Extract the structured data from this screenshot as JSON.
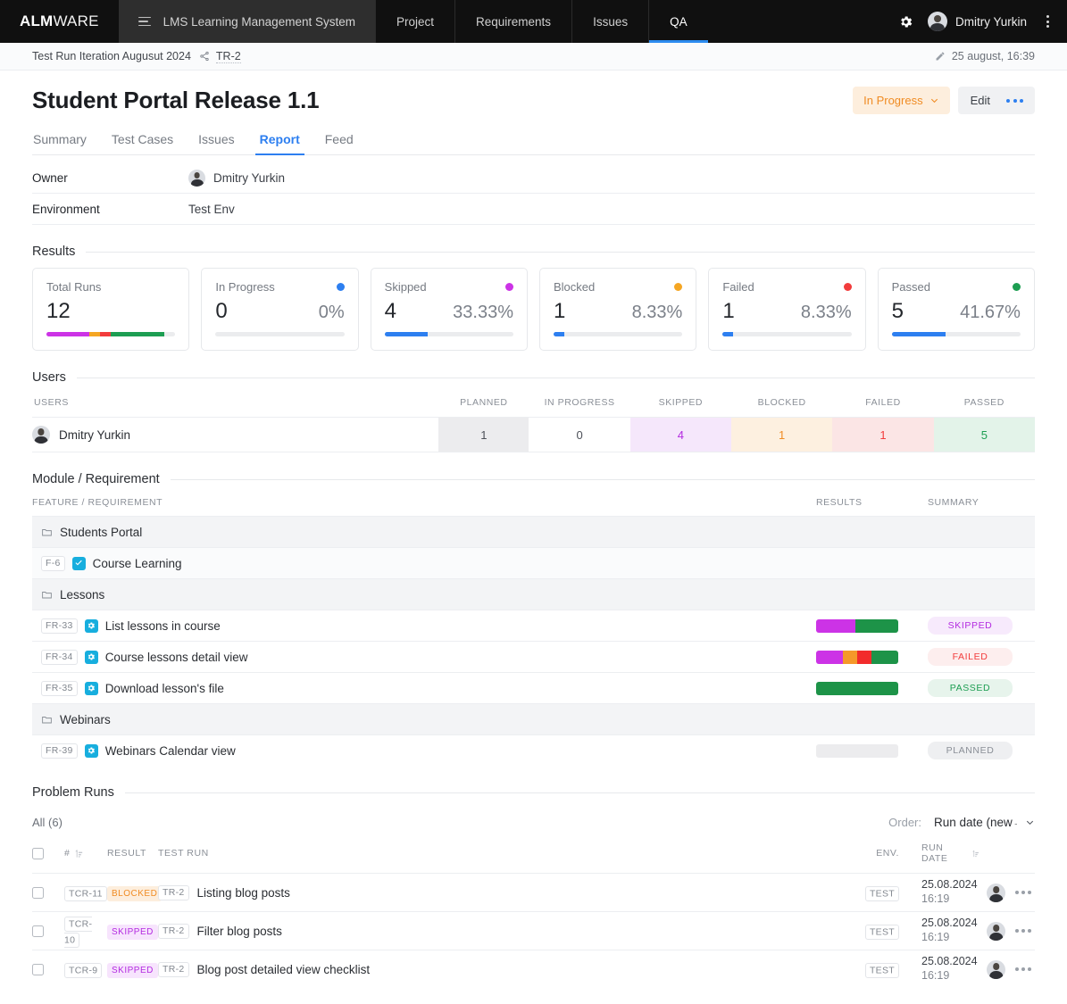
{
  "topnav": {
    "brand_bold": "ALM",
    "brand_light": "WARE",
    "project": "LMS Learning Management System",
    "items": [
      {
        "label": "Project",
        "active": false
      },
      {
        "label": "Requirements",
        "active": false
      },
      {
        "label": "Issues",
        "active": false
      },
      {
        "label": "QA",
        "active": true
      }
    ],
    "user": "Dmitry Yurkin"
  },
  "breadcrumb": {
    "parent": "Test Run Iteration Augusut 2024",
    "key": "TR-2",
    "edited": "25 august, 16:39"
  },
  "header": {
    "title": "Student Portal Release 1.1",
    "status": "In Progress",
    "edit_label": "Edit"
  },
  "tabs": [
    {
      "label": "Summary",
      "active": false
    },
    {
      "label": "Test Cases",
      "active": false
    },
    {
      "label": "Issues",
      "active": false
    },
    {
      "label": "Report",
      "active": true
    },
    {
      "label": "Feed",
      "active": false
    }
  ],
  "details": {
    "owner_label": "Owner",
    "owner_value": "Dmitry Yurkin",
    "environment_label": "Environment",
    "environment_value": "Test Env"
  },
  "results": {
    "heading": "Results",
    "cards": [
      {
        "label": "Total Runs",
        "value": "12",
        "percent": "",
        "dot": "",
        "segmented": true
      },
      {
        "label": "In Progress",
        "value": "0",
        "percent": "0%",
        "dot": "#2d7ff0",
        "fill": 0
      },
      {
        "label": "Skipped",
        "value": "4",
        "percent": "33.33%",
        "dot": "#cc33e6",
        "fill": 33.33
      },
      {
        "label": "Blocked",
        "value": "1",
        "percent": "8.33%",
        "dot": "#f5a623",
        "fill": 8.33
      },
      {
        "label": "Failed",
        "value": "1",
        "percent": "8.33%",
        "dot": "#f23c3c",
        "fill": 8.33
      },
      {
        "label": "Passed",
        "value": "5",
        "percent": "41.67%",
        "dot": "#1d9e52",
        "fill": 41.67
      }
    ],
    "total_segments": [
      {
        "color": "#cc33e6",
        "pct": 33.33
      },
      {
        "color": "#f5a623",
        "pct": 8.33
      },
      {
        "color": "#f23c3c",
        "pct": 8.33
      },
      {
        "color": "#1d9e52",
        "pct": 41.67
      }
    ]
  },
  "users": {
    "heading": "Users",
    "columns": [
      "USERS",
      "PLANNED",
      "IN PROGRESS",
      "SKIPPED",
      "BLOCKED",
      "FAILED",
      "PASSED"
    ],
    "rows": [
      {
        "name": "Dmitry Yurkin",
        "planned": "1",
        "in_progress": "0",
        "skipped": "4",
        "blocked": "1",
        "failed": "1",
        "passed": "5"
      }
    ]
  },
  "module": {
    "heading": "Module / Requirement",
    "columns": {
      "feature": "FEATURE / REQUIREMENT",
      "results": "RESULTS",
      "summary": "SUMMARY"
    },
    "rows": [
      {
        "kind": "folder",
        "name": "Students Portal",
        "key": "",
        "bar": [],
        "summary": ""
      },
      {
        "kind": "item",
        "name": "Course Learning",
        "key": "F-6",
        "bar": [],
        "summary": ""
      },
      {
        "kind": "folder",
        "name": "Lessons",
        "key": "",
        "bar": [],
        "summary": ""
      },
      {
        "kind": "item",
        "name": "List lessons in course",
        "key": "FR-33",
        "bar": [
          {
            "color": "#cc33e6",
            "pct": 48
          },
          {
            "color": "#1d9348",
            "pct": 52
          }
        ],
        "summary": "SKIPPED",
        "summary_class": "s-skipped"
      },
      {
        "kind": "item",
        "name": "Course lessons detail view",
        "key": "FR-34",
        "bar": [
          {
            "color": "#cc33e6",
            "pct": 33
          },
          {
            "color": "#f5982a",
            "pct": 17
          },
          {
            "color": "#f22b2b",
            "pct": 17
          },
          {
            "color": "#1d9348",
            "pct": 33
          }
        ],
        "summary": "FAILED",
        "summary_class": "s-failed"
      },
      {
        "kind": "item",
        "name": "Download lesson's file",
        "key": "FR-35",
        "bar": [
          {
            "color": "#1d9348",
            "pct": 100
          }
        ],
        "summary": "PASSED",
        "summary_class": "s-passed"
      },
      {
        "kind": "folder",
        "name": "Webinars",
        "key": "",
        "bar": [],
        "summary": ""
      },
      {
        "kind": "item",
        "name": "Webinars Calendar view",
        "key": "FR-39",
        "bar": [],
        "summary": "PLANNED",
        "summary_class": "s-planned"
      }
    ]
  },
  "problem_runs": {
    "heading": "Problem Runs",
    "all_label": "All (6)",
    "order_label": "Order:",
    "order_value": "Run date (new→o",
    "columns": {
      "num": "#",
      "result": "RESULT",
      "test_run": "TEST RUN",
      "env": "ENV.",
      "run_date": "RUN DATE"
    },
    "rows": [
      {
        "key": "TCR-11",
        "result": "BLOCKED",
        "result_class": "r-blocked",
        "run_key": "TR-2",
        "title": "Listing blog posts",
        "env": "TEST",
        "date": "25.08.2024",
        "time": "16:19"
      },
      {
        "key": "TCR-10",
        "result": "SKIPPED",
        "result_class": "r-skipped",
        "run_key": "TR-2",
        "title": "Filter blog posts",
        "env": "TEST",
        "date": "25.08.2024",
        "time": "16:19"
      },
      {
        "key": "TCR-9",
        "result": "SKIPPED",
        "result_class": "r-skipped",
        "run_key": "TR-2",
        "title": "Blog post detailed view checklist",
        "env": "TEST",
        "date": "25.08.2024",
        "time": "16:19"
      }
    ]
  }
}
